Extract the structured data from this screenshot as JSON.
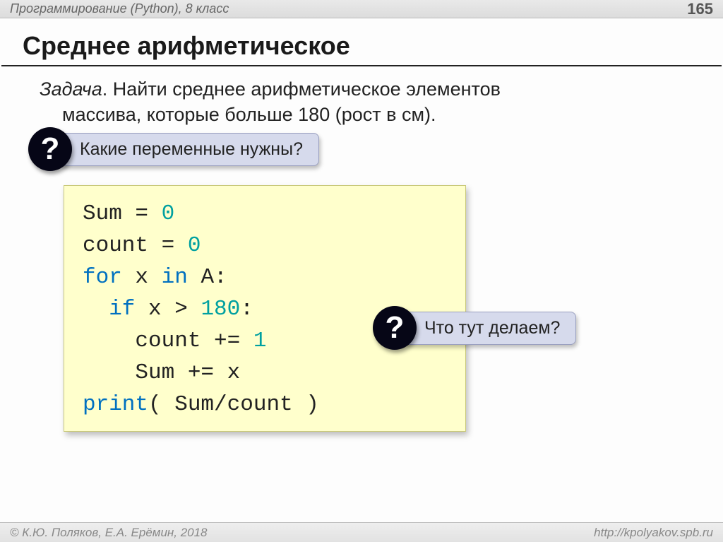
{
  "header": {
    "course": "Программирование (Python), 8 класс",
    "page": "165"
  },
  "title": "Среднее арифметическое",
  "task": {
    "label": "Задача",
    "line1": ". Найти среднее арифметическое элементов",
    "line2": "массива, которые больше 180 (рост в см)."
  },
  "callout1": {
    "badge": "?",
    "text": "Какие переменные нужны?"
  },
  "callout2": {
    "badge": "?",
    "text": "Что тут делаем?"
  },
  "code": {
    "l1a": "Sum = ",
    "l1n": "0",
    "l2a": "count = ",
    "l2n": "0",
    "l3a": "for",
    "l3b": " x ",
    "l3c": "in",
    "l3d": " A:",
    "l4a": "  if",
    "l4b": " x > ",
    "l4n": "180",
    "l4c": ":",
    "l5a": "    count += ",
    "l5n": "1",
    "l6a": "    Sum += x",
    "l7a": "print",
    "l7b": "( Sum/count )"
  },
  "footer": {
    "left": "© К.Ю. Поляков, Е.А. Ерёмин, 2018",
    "right": "http://kpolyakov.spb.ru"
  }
}
